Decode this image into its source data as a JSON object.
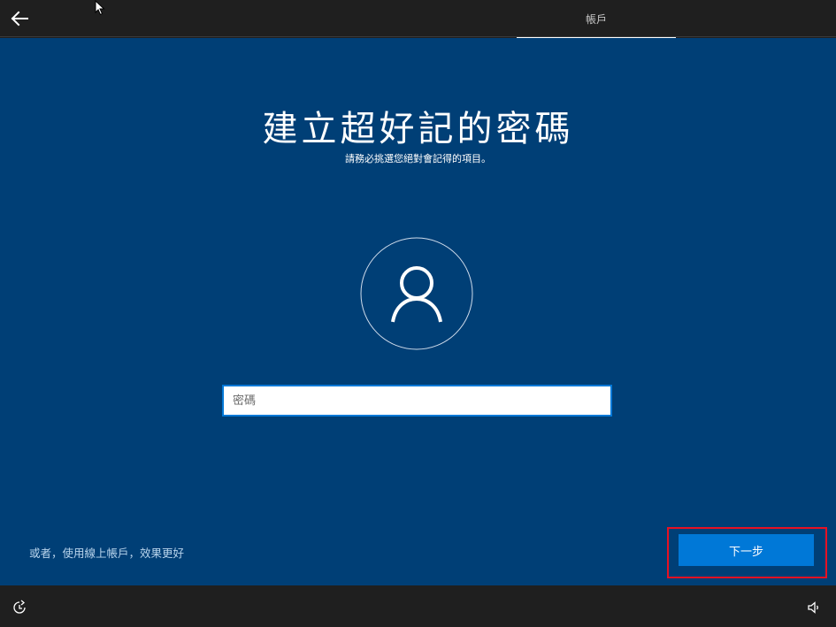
{
  "topbar": {
    "back_icon": "back-arrow-icon",
    "tab_label": "帳戶"
  },
  "main": {
    "title": "建立超好記的密碼",
    "subtitle": "請務必挑選您絕對會記得的項目。",
    "avatar_icon": "user-icon",
    "password_placeholder": "密碼",
    "password_value": "",
    "online_account_link": "或者，使用線上帳戶，效果更好",
    "next_button": "下一步"
  },
  "bottombar": {
    "accessibility_icon": "ease-of-access-icon",
    "volume_icon": "volume-icon"
  },
  "colors": {
    "background": "#003f76",
    "chrome": "#1f1f1f",
    "accent": "#0078d7",
    "highlight_border": "#e81123"
  }
}
